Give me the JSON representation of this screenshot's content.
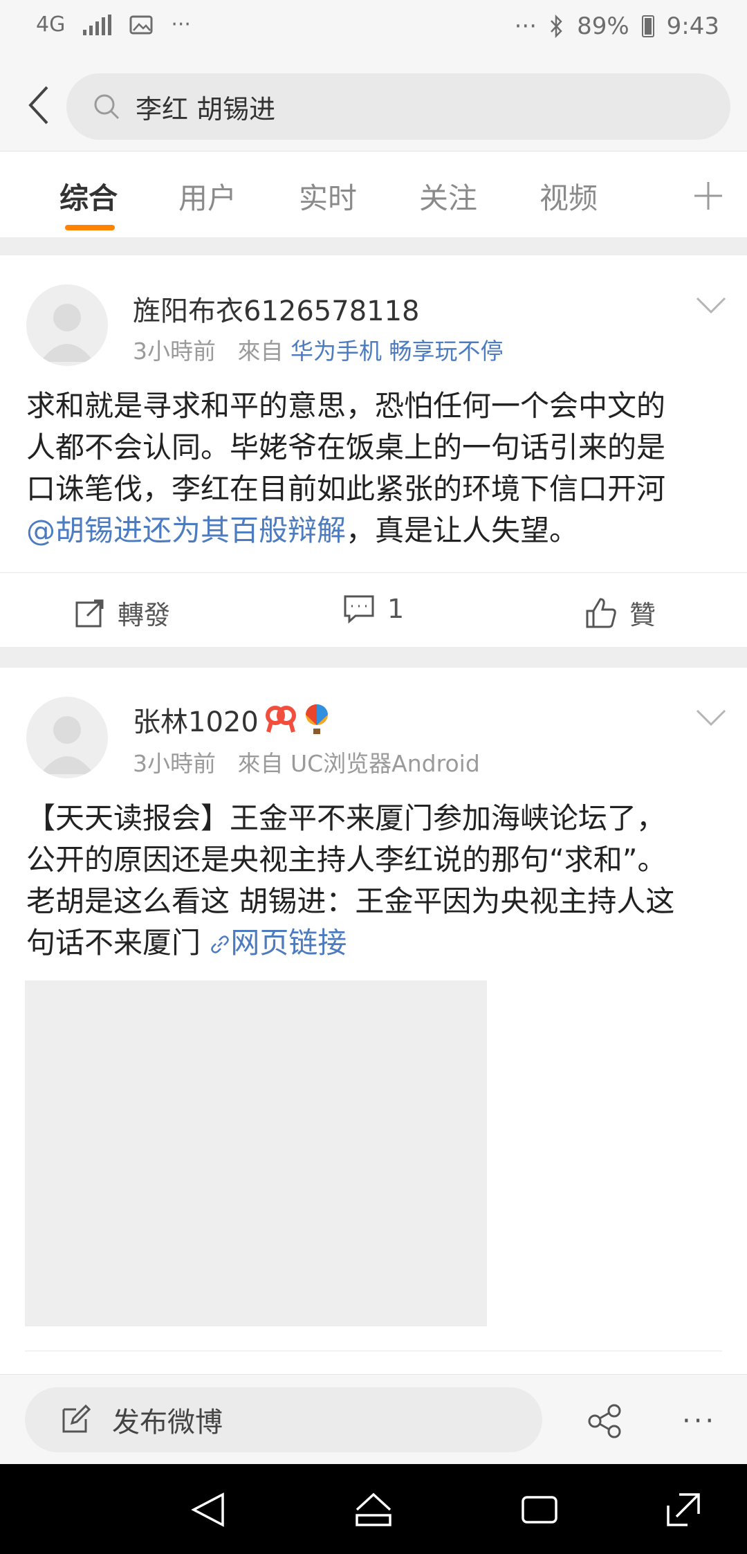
{
  "status_bar": {
    "network": "4G",
    "dots_left": "···",
    "dots_right": "···",
    "battery": "89%",
    "time": "9:43"
  },
  "search": {
    "query": "李红 胡锡进"
  },
  "tabs": [
    {
      "label": "综合",
      "active": true
    },
    {
      "label": "用户"
    },
    {
      "label": "实时"
    },
    {
      "label": "关注"
    },
    {
      "label": "视频"
    }
  ],
  "posts": [
    {
      "username": "旌阳布衣6126578118",
      "time": "3小時前",
      "from_label": "來自",
      "source": "华为手机 畅享玩不停",
      "text_lines": [
        "求和就是寻求和平的意思，恐怕任何一个会中文的",
        "人都不会认同。毕姥爷在饭桌上的一句话引来的是",
        "口诛笔伐，李红在目前如此紧张的环境下信口开河"
      ],
      "mention": "@胡锡进还为其百般辩解",
      "text_tail": "，真是让人失望。",
      "actions": {
        "repost": "轉發",
        "comments": "1",
        "like": "贊"
      }
    },
    {
      "username": "张林1020",
      "time": "3小時前",
      "from_label": "來自",
      "source": "UC浏览器Android",
      "text_lines": [
        "【天天读报会】王金平不来厦门参加海峡论坛了，",
        "公开的原因还是央视主持人李红说的那句“求和”。",
        "老胡是这么看这 胡锡进：王金平因为央视主持人这"
      ],
      "text_last": "句话不来厦门",
      "link_text": "网页链接"
    }
  ],
  "bottom_bar": {
    "compose_label": "发布微博",
    "more": "···"
  },
  "colors": {
    "accent": "#ff8200",
    "link": "#4c7bbf"
  }
}
